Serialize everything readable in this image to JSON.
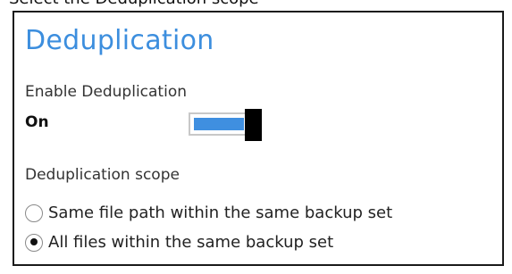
{
  "caption": "Select the Deduplication scope",
  "panel": {
    "title": "Deduplication",
    "enable_label": "Enable Deduplication",
    "enable_state": "On",
    "enable_toggle_on": true,
    "scope_label": "Deduplication scope",
    "scope_options": [
      {
        "label": "Same file path within the same backup set",
        "selected": false
      },
      {
        "label": "All files within the same backup set",
        "selected": true
      }
    ]
  },
  "colors": {
    "title": "#3c8ede",
    "toggle_fill": "#3f8fe0",
    "toggle_knob": "#000000",
    "panel_border": "#1a1a1a"
  }
}
